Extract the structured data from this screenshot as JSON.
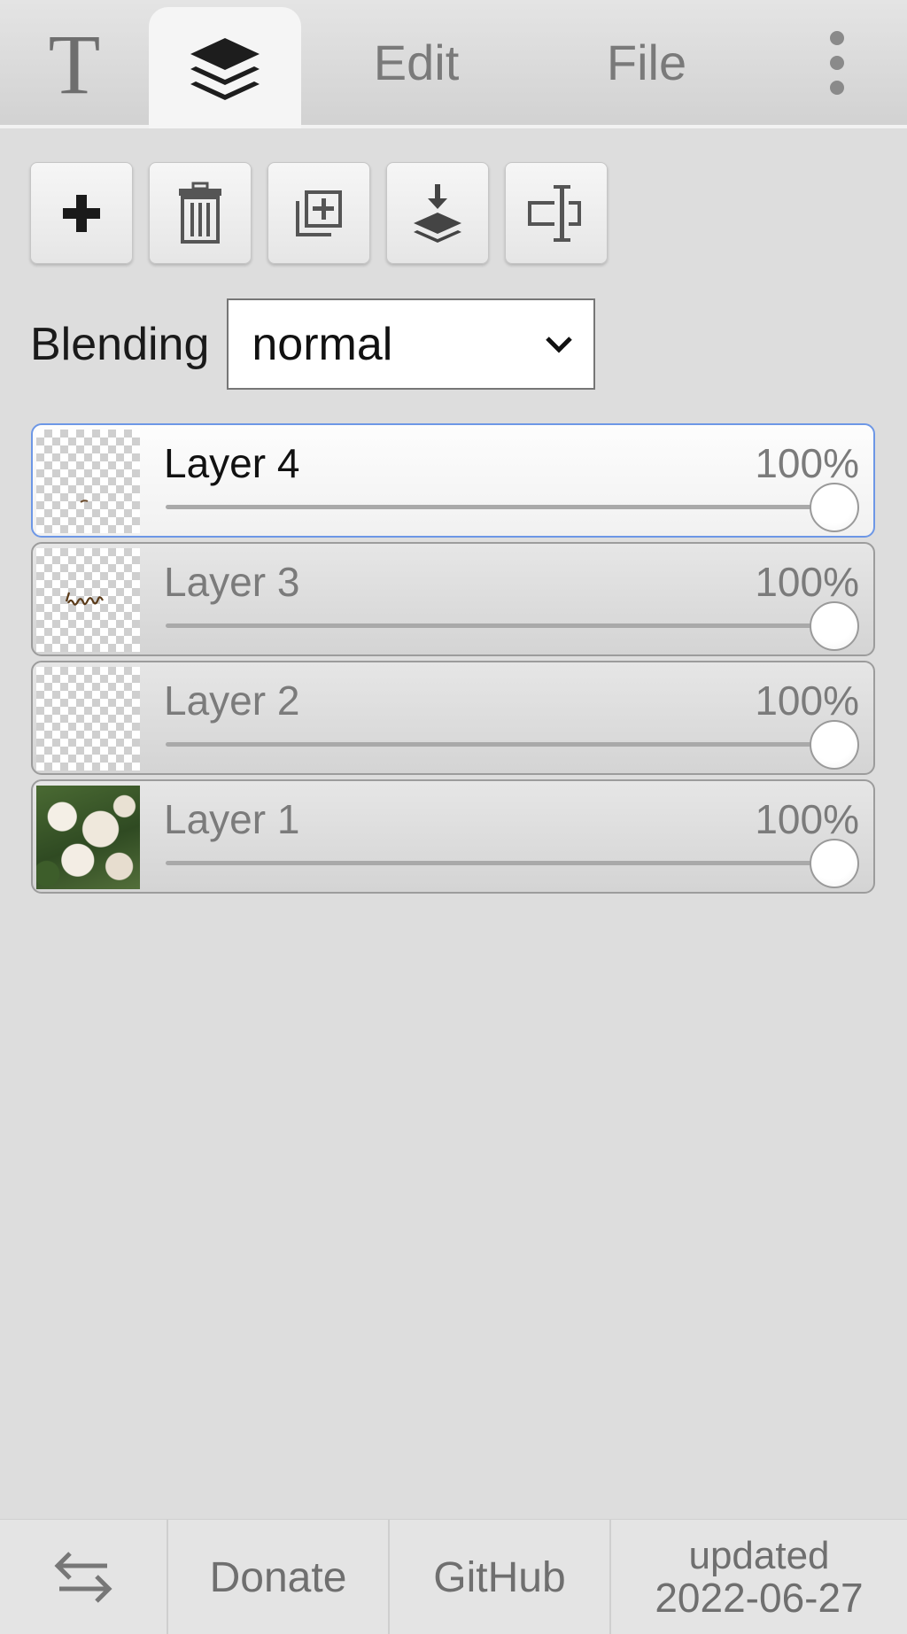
{
  "tabs": {
    "text_tool_glyph": "T",
    "layers_icon": "layers-icon",
    "edit_label": "Edit",
    "file_label": "File",
    "more_icon": "vertical-ellipsis-icon"
  },
  "toolbar": {
    "buttons": [
      {
        "icon": "plus-icon"
      },
      {
        "icon": "trash-icon"
      },
      {
        "icon": "duplicate-icon"
      },
      {
        "icon": "merge-down-icon"
      },
      {
        "icon": "rename-icon"
      }
    ]
  },
  "blending": {
    "label": "Blending",
    "selected": "normal"
  },
  "layers": [
    {
      "name": "Layer 4",
      "opacity_label": "100%",
      "opacity": 1.0,
      "active": true,
      "thumb": "transparent"
    },
    {
      "name": "Layer 3",
      "opacity_label": "100%",
      "opacity": 1.0,
      "active": false,
      "thumb": "text-scribble"
    },
    {
      "name": "Layer 2",
      "opacity_label": "100%",
      "opacity": 1.0,
      "active": false,
      "thumb": "transparent"
    },
    {
      "name": "Layer 1",
      "opacity_label": "100%",
      "opacity": 1.0,
      "active": false,
      "thumb": "photo-flowers"
    }
  ],
  "footer": {
    "swap_icon": "swap-arrows-icon",
    "donate_label": "Donate",
    "github_label": "GitHub",
    "updated_label": "updated",
    "updated_date": "2022-06-27"
  },
  "colors": {
    "background": "#dddddd",
    "active_layer_border": "#6d97e6",
    "muted_text": "#7b7b7b"
  }
}
